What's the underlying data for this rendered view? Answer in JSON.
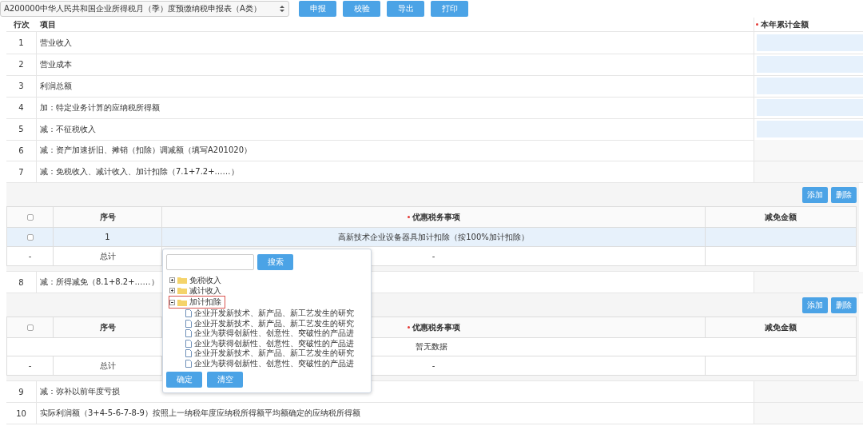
{
  "toolbar": {
    "form_select": "A200000中华人民共和国企业所得税月（季）度预缴纳税申报表（A类）",
    "buttons": [
      "申报",
      "校验",
      "导出",
      "打印"
    ]
  },
  "main_table": {
    "columns": [
      {
        "label": "行次",
        "required": false
      },
      {
        "label": "项目",
        "required": false
      },
      {
        "label": "本年累计金额",
        "required": true
      }
    ],
    "rows": [
      {
        "no": "1",
        "item": "营业收入",
        "editable": true
      },
      {
        "no": "2",
        "item": "营业成本",
        "editable": true
      },
      {
        "no": "3",
        "item": "利润总额",
        "editable": true
      },
      {
        "no": "4",
        "item": "加：特定业务计算的应纳税所得额",
        "editable": true
      },
      {
        "no": "5",
        "item": "减：不征税收入",
        "editable": true
      },
      {
        "no": "6",
        "item": "减：资产加速折旧、摊销（扣除）调减额（填写A201020）",
        "editable": false
      },
      {
        "no": "7",
        "item": "减：免税收入、减计收入、加计扣除（7.1+7.2+……）",
        "editable": false,
        "detail": {
          "buttons": [
            "添加",
            "删除"
          ],
          "select_all_checked": false,
          "columns": [
            {
              "label": "序号",
              "required": false
            },
            {
              "label": "优惠税务事项",
              "required": true
            },
            {
              "label": "减免金额",
              "required": false
            }
          ],
          "rows": [
            {
              "checked": false,
              "selected": true,
              "no": "1",
              "item": "高新技术企业设备器具加计扣除（按100%加计扣除）"
            }
          ],
          "total": {
            "marker": "-",
            "label": "总计",
            "item": "-"
          }
        }
      },
      {
        "no": "8",
        "item": "减：所得减免（8.1+8.2+……）",
        "editable": false,
        "detail": {
          "buttons": [
            "添加",
            "删除"
          ],
          "select_all_checked": false,
          "columns": [
            {
              "label": "序号",
              "required": false
            },
            {
              "label": "优惠税务事项",
              "required": true
            },
            {
              "label": "减免金额",
              "required": false
            }
          ],
          "empty_text": "暂无数据",
          "total": {
            "marker": "-",
            "label": "总计",
            "item": "-"
          }
        }
      },
      {
        "no": "9",
        "item": "减：弥补以前年度亏损",
        "editable": false
      },
      {
        "no": "10",
        "item": "实际利润额（3+4-5-6-7-8-9）按照上一纳税年度应纳税所得额平均额确定的应纳税所得额",
        "editable": false
      }
    ]
  },
  "picker": {
    "search_button": "搜索",
    "tree": [
      {
        "label": "免税收入",
        "expanded": false,
        "highlighted": false
      },
      {
        "label": "减计收入",
        "expanded": false,
        "highlighted": false
      },
      {
        "label": "加计扣除",
        "expanded": true,
        "highlighted": true,
        "children": [
          {
            "label": "企业开发新技术、新产品、新工艺发生的研究"
          },
          {
            "label": "企业开发新技术、新产品、新工艺发生的研究"
          },
          {
            "label": "企业为获得创新性、创意性、突破性的产品进"
          },
          {
            "label": "企业为获得创新性、创意性、突破性的产品进"
          },
          {
            "label": "企业开发新技术、新产品、新工艺发生的研究"
          },
          {
            "label": "企业为获得创新性、创意性、突破性的产品进"
          }
        ]
      }
    ],
    "buttons": [
      "确定",
      "清空"
    ]
  }
}
